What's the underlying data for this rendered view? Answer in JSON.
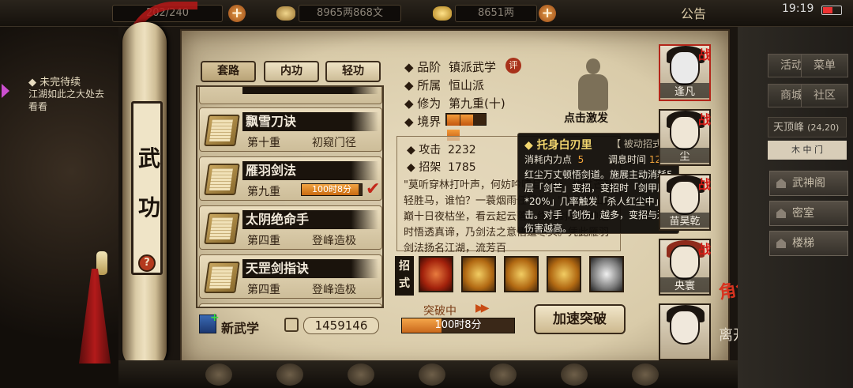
{
  "topbar": {
    "stamina": "202/240",
    "money": "8965两868文",
    "gold": "8651两",
    "announcement": "公告",
    "time": "19:19"
  },
  "left_panel": {
    "task_title": "◆ 未完待续",
    "task_text": "江湖如此之大处去看看",
    "scroll_chars": [
      "武",
      "功"
    ],
    "help": "?"
  },
  "tabs": [
    {
      "label": "套路",
      "active": true
    },
    {
      "label": "内功",
      "active": false
    },
    {
      "label": "轻功",
      "active": false
    }
  ],
  "skills": [
    {
      "name": "飘雪刀诀",
      "level": "第十重",
      "tag": "初窥门径"
    },
    {
      "name": "雁羽剑法",
      "level": "第九重",
      "progress_text": "100时8分",
      "progress": 0.95,
      "selected": true
    },
    {
      "name": "太阴绝命手",
      "level": "第四重",
      "tag": "登峰造极"
    },
    {
      "name": "天罡剑指诀",
      "level": "第四重",
      "tag": "登峰造极"
    }
  ],
  "bottom_left": {
    "new_label": "新武学",
    "points": "1459146"
  },
  "info": {
    "grade_key": "◆ 品阶",
    "grade_val": "镇派武学",
    "eval_badge": "评",
    "sect_key": "◆ 所属",
    "sect_val": "恒山派",
    "train_key": "◆ 修为",
    "train_val": "第九重(十)",
    "realm_key": "◆ 境界",
    "realm_level": 3,
    "figure_caption": "点击激发"
  },
  "stats": {
    "attack_key": "◆ 攻击",
    "attack_val": "2232",
    "parry_key": "◆ 招架",
    "parry_val": "1785",
    "desc": "\"莫听穿林打叶声，何妨吟啸且徐行。竹杖芒鞋轻胜马，谁怕？一蓑烟雨任平生。\"你于恒山之巅十日夜枯坐，看云起云落，终明剑心通神道时悟透真谛，乃剑法之意悟道尽头。凭此雁羽剑法扬名江湖，流芳百"
  },
  "moves_label": "招式",
  "moves": [
    {
      "icon": "red-sword-move-icon",
      "style": "red"
    },
    {
      "icon": "gold-slash-move-icon",
      "style": "gold"
    },
    {
      "icon": "gold-cross-move-icon",
      "style": "gold"
    },
    {
      "icon": "gold-swirl-move-icon",
      "style": "gold"
    },
    {
      "icon": "lightning-move-icon",
      "style": "gray"
    }
  ],
  "breakthrough": {
    "label": "突破中",
    "time_text": "100时8分",
    "progress": 0.35,
    "speed_button": "加速突破"
  },
  "tooltip": {
    "title": "◆ 托身白刃里",
    "type": "【 被动招式 】",
    "cost_label": "消耗内力点",
    "cost_val": "5",
    "cooldown_label": "调息时间",
    "cooldown_val": "12",
    "desc": "红尘万丈顿悟剑道。施展主动消耗5层「剑芒」变招，变招时「剑甲层数*20%」几率触发「杀人红尘中」连击。对手「剑伤」越多，变招与连击伤害越高。"
  },
  "characters": [
    {
      "name": "逢凡"
    },
    {
      "name": "尘"
    },
    {
      "name": "苗昊乾"
    },
    {
      "name": "央寰"
    },
    {
      "name": ""
    }
  ],
  "char_tag": "战",
  "role_text": "角色",
  "leave_text": "离开",
  "right_menu": {
    "buttons": [
      "活动",
      "菜单",
      "商城",
      "社区"
    ],
    "location": "天顶峰",
    "coords": "(24,20)",
    "loc_tabs": "木 中 门",
    "places": [
      "武神阁",
      "密室",
      "楼梯"
    ]
  },
  "colors": {
    "accent_red": "#c3281a",
    "progress_orange": "#f2a543",
    "tooltip_gold": "#f2d66f"
  }
}
